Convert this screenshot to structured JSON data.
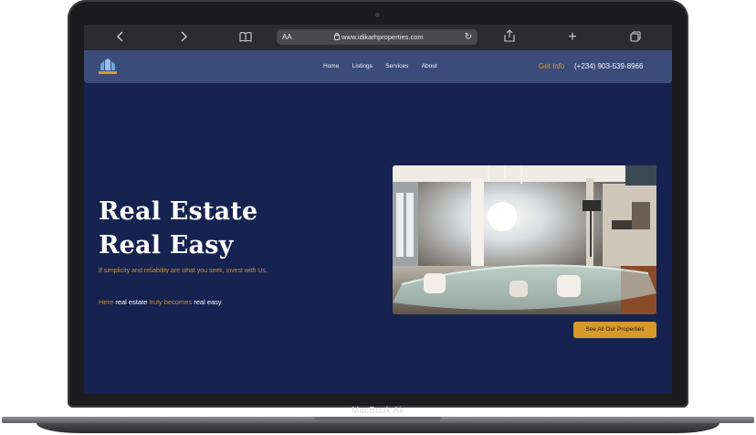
{
  "device": {
    "label": "MacBook Air"
  },
  "browser": {
    "reader_label": "AA",
    "url": "www.idikarhproperties.com",
    "icons": [
      "back-icon",
      "forward-icon",
      "bookmarks-icon",
      "lock-icon",
      "reload-icon",
      "share-icon",
      "new-tab-icon",
      "tabs-icon"
    ]
  },
  "site": {
    "nav": {
      "items": [
        "Home",
        "Listings",
        "Services",
        "About"
      ],
      "get_info_label": "Get Info",
      "phone": "(+234) 903-539-8966"
    },
    "hero": {
      "headline_line1": "Real Estate",
      "headline_line2": "Real Easy",
      "tagline": "If simplicity and reliability are what you seek, invest with Us.",
      "subline_part1": "Here ",
      "subline_highlight1": "real estate",
      "subline_part2": " truly becomes ",
      "subline_highlight2": "real easy",
      "subline_part3": ".",
      "cta_label": "See All Our Properties"
    },
    "colors": {
      "background": "#16224f",
      "nav": "#3c4c7a",
      "accent": "#d79a2a",
      "text": "#ffffff"
    }
  }
}
